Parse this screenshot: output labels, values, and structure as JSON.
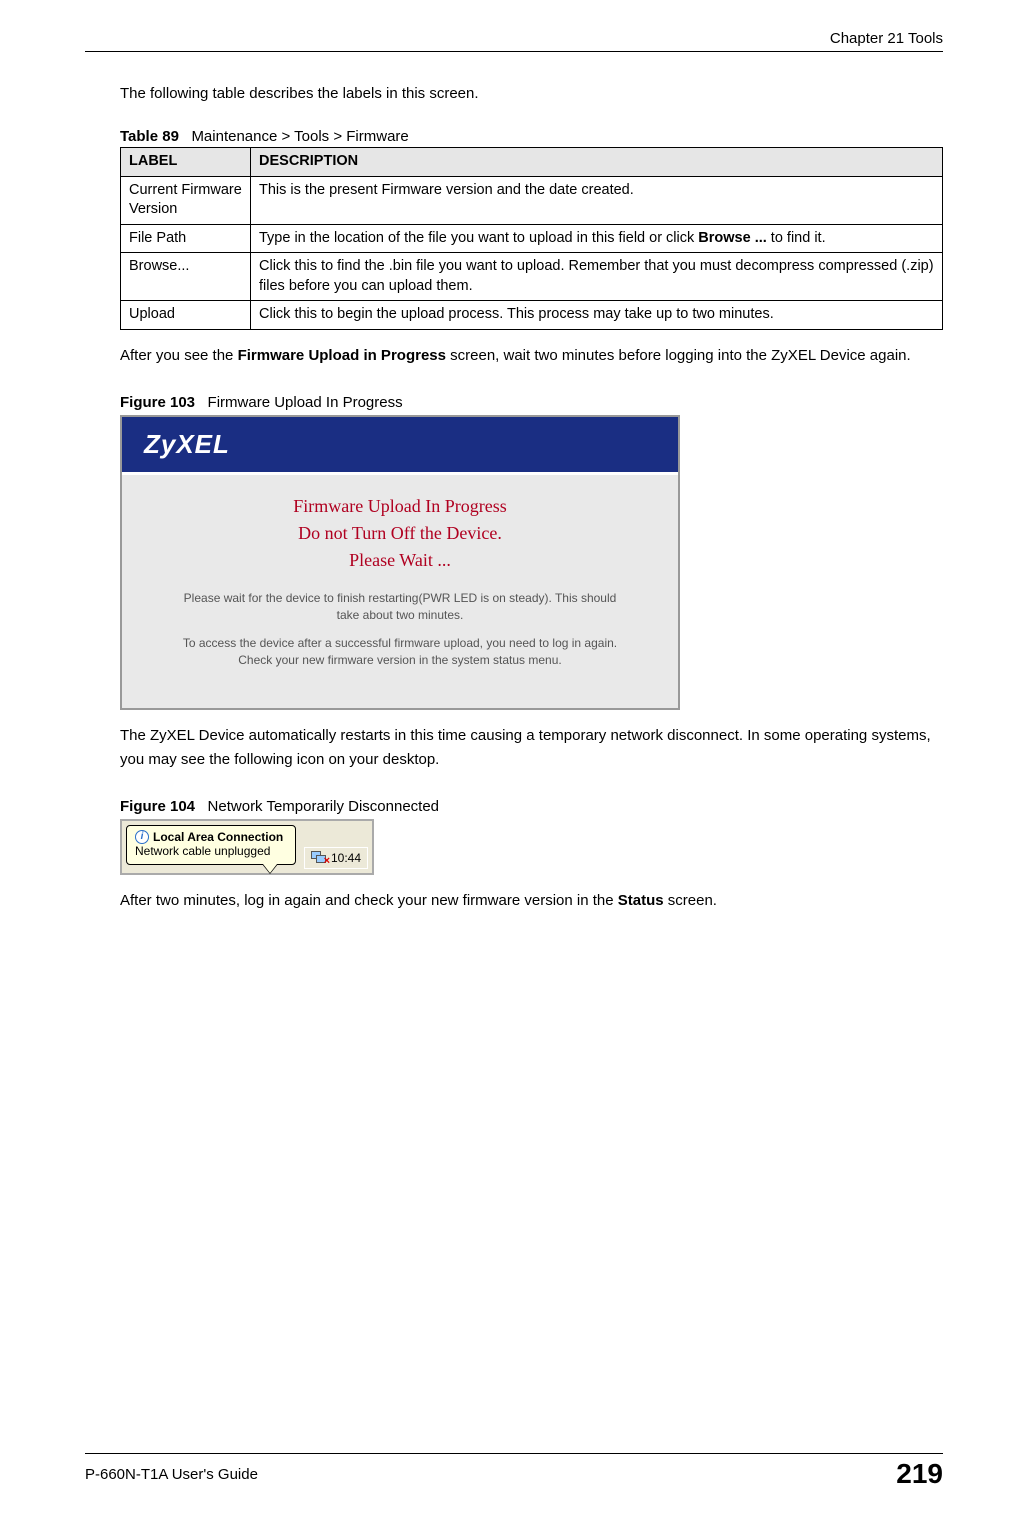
{
  "header": {
    "chapter": "Chapter 21 Tools"
  },
  "intro_para": "The following table describes the labels in this screen.",
  "table89": {
    "caption_number": "Table 89",
    "caption_text": "Maintenance > Tools > Firmware",
    "col_headers": {
      "label": "LABEL",
      "desc": "DESCRIPTION"
    },
    "rows": [
      {
        "label": "Current Firmware Version",
        "desc": "This is the present Firmware version and the date created."
      },
      {
        "label": "File Path",
        "desc_parts": {
          "pre": "Type in the location of the file you want to upload in this field or click ",
          "bold": "Browse ...",
          "post": " to find it."
        }
      },
      {
        "label": "Browse...",
        "desc": "Click this to find the .bin file you want to upload. Remember that you must decompress compressed (.zip) files before you can upload them."
      },
      {
        "label": "Upload",
        "desc": "Click this to begin the upload process. This process may take up to two minutes."
      }
    ]
  },
  "after_table_para": {
    "pre": "After you see the ",
    "bold": "Firmware Upload in Progress",
    "post": " screen, wait two minutes before logging into the ZyXEL Device again."
  },
  "figure103": {
    "caption_number": "Figure 103",
    "caption_text": "Firmware Upload In Progress",
    "logo": "ZyXEL",
    "red_line1": "Firmware Upload In Progress",
    "red_line2": "Do not Turn Off the Device.",
    "red_line3": "Please Wait ...",
    "gray1": "Please wait for the device to finish restarting(PWR LED is on steady). This should take about two minutes.",
    "gray2": "To access the device after a successful firmware upload, you need to log in again. Check your new firmware version in the system status menu."
  },
  "restart_para": "The ZyXEL Device automatically restarts in this time causing a temporary network disconnect. In some operating systems, you may see the following icon on your desktop.",
  "figure104": {
    "caption_number": "Figure 104",
    "caption_text": "Network Temporarily Disconnected",
    "balloon_title": "Local Area Connection",
    "balloon_body": "Network cable unplugged",
    "clock": "10:44"
  },
  "final_para": {
    "pre": "After two minutes, log in again and check your new firmware version in the ",
    "bold": "Status",
    "post": " screen."
  },
  "footer": {
    "guide": "P-660N-T1A User's Guide",
    "page": "219"
  }
}
